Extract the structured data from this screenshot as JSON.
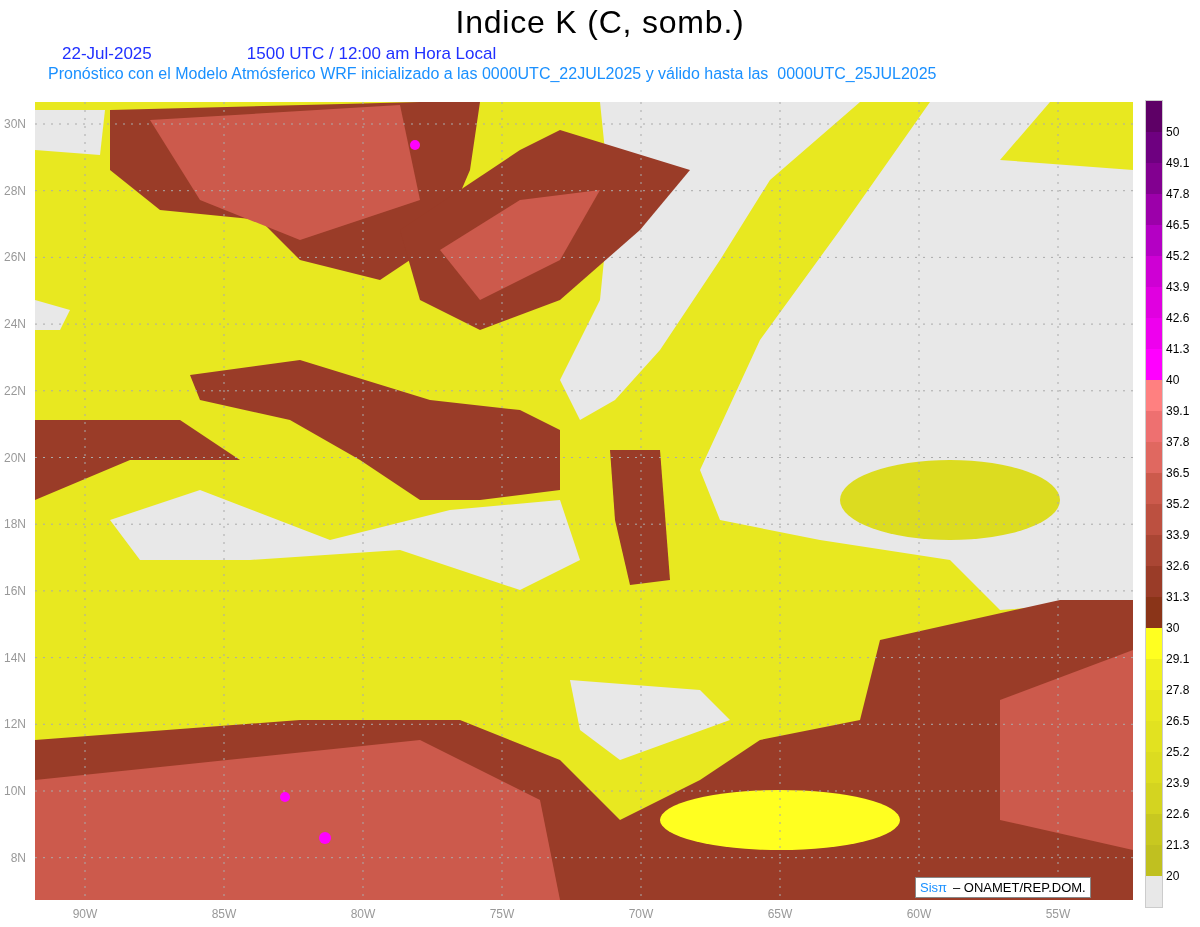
{
  "title": "Indice K (C, somb.)",
  "header": {
    "date": "22-Jul-2025",
    "time": "1500 UTC / 12:00 am Hora Local",
    "description": "Pronóstico con el Modelo Atmósferico WRF inicializado a las 0000UTC_22JUL2025 y válido hasta las  0000UTC_25JUL2025"
  },
  "map": {
    "latitude_labels": [
      "30N",
      "28N",
      "26N",
      "24N",
      "22N",
      "20N",
      "18N",
      "16N",
      "14N",
      "12N",
      "10N",
      "8N"
    ],
    "longitude_labels": [
      "90W",
      "85W",
      "80W",
      "75W",
      "70W",
      "65W",
      "60W",
      "55W"
    ]
  },
  "legend": [
    {
      "label": "50",
      "color": "#5e0066"
    },
    {
      "label": "49.1",
      "color": "#6e0080"
    },
    {
      "label": "47.8",
      "color": "#820090"
    },
    {
      "label": "46.5",
      "color": "#9c00aa"
    },
    {
      "label": "45.2",
      "color": "#b400c4"
    },
    {
      "label": "43.9",
      "color": "#ce00d4"
    },
    {
      "label": "42.6",
      "color": "#e000e0"
    },
    {
      "label": "41.3",
      "color": "#ee00ee"
    },
    {
      "label": "40",
      "color": "#ff00ff"
    },
    {
      "label": "39.1",
      "color": "#ff8080"
    },
    {
      "label": "37.8",
      "color": "#ee7070"
    },
    {
      "label": "36.5",
      "color": "#e06860"
    },
    {
      "label": "35.2",
      "color": "#cc5a4c"
    },
    {
      "label": "33.9",
      "color": "#bc5040"
    },
    {
      "label": "32.6",
      "color": "#aa4634"
    },
    {
      "label": "31.3",
      "color": "#9a3c28"
    },
    {
      "label": "30",
      "color": "#8a3418"
    },
    {
      "label": "29.1",
      "color": "#ffff20"
    },
    {
      "label": "27.8",
      "color": "#f0f020"
    },
    {
      "label": "26.5",
      "color": "#e8e820"
    },
    {
      "label": "25.2",
      "color": "#e2e220"
    },
    {
      "label": "23.9",
      "color": "#dcdc20"
    },
    {
      "label": "22.6",
      "color": "#d4d420"
    },
    {
      "label": "21.3",
      "color": "#c8c820"
    },
    {
      "label": "20",
      "color": "#c0c020"
    },
    {
      "color": "#e8e8e8"
    }
  ],
  "credit": {
    "logo": "Sisπ",
    "text": "– ONAMET/REP.DOM."
  }
}
